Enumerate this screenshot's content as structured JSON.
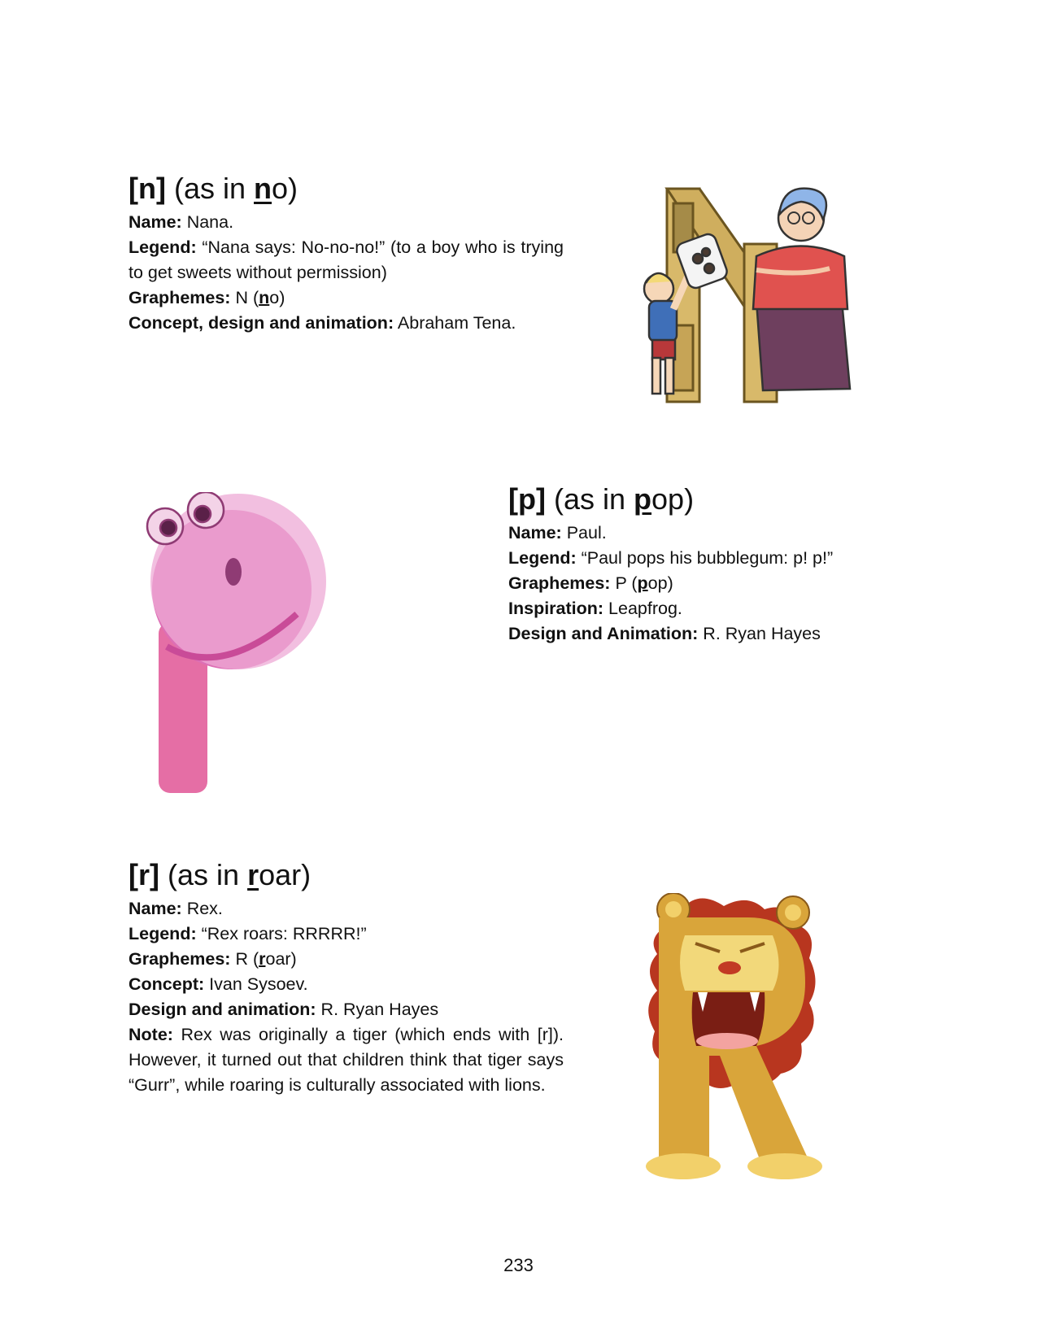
{
  "sections": [
    {
      "symbol": "[n]",
      "as_in": "(as in ",
      "kw_bold": "n",
      "kw_rest": "o)",
      "rows": [
        {
          "label": "Name:",
          "value": " Nana."
        },
        {
          "label": "Legend:",
          "value": " “Nana says: No-no-no!” (to a boy who is trying to get sweets without permission)"
        },
        {
          "label": "Graphemes:",
          "value_a": " N (",
          "value_bold": "n",
          "value_b": "o)"
        },
        {
          "label": "Concept, design and animation:",
          "value": " Abraham Tena."
        }
      ]
    },
    {
      "symbol": "[p]",
      "as_in": "(as in ",
      "kw_bold": "p",
      "kw_rest": "op)",
      "rows": [
        {
          "label": "Name:",
          "value": " Paul."
        },
        {
          "label": "Legend:",
          "value": " “Paul pops his bubblegum: p! p!”"
        },
        {
          "label": "Graphemes:",
          "value_a": " P (",
          "value_bold": "p",
          "value_b": "op)"
        },
        {
          "label": "Inspiration:",
          "value": " Leapfrog."
        },
        {
          "label": "Design and Animation:",
          "value": " R. Ryan Hayes"
        }
      ]
    },
    {
      "symbol": "[r]",
      "as_in": "(as in ",
      "kw_bold": "r",
      "kw_rest": "oar)",
      "rows": [
        {
          "label": "Name:",
          "value": " Rex."
        },
        {
          "label": "Legend:",
          "value": " “Rex roars: RRRRR!”"
        },
        {
          "label": "Graphemes:",
          "value_a": " R (",
          "value_bold": "r",
          "value_b": "oar)"
        },
        {
          "label": "Concept:",
          "value": " Ivan Sysoev."
        },
        {
          "label": "Design and animation:",
          "value": " R. Ryan Hayes"
        },
        {
          "label": "Note:",
          "value": " Rex was originally a tiger (which ends with [r]). However, it turned out that children think that tiger says “Gurr”, while roaring is culturally associated with lions."
        }
      ]
    }
  ],
  "page_number": "233",
  "colors": {
    "door": "#d8b96a",
    "nana_shirt": "#e0524f",
    "nana_skirt": "#6e3f5e",
    "nana_hair": "#8fb5e8",
    "boy_shirt": "#3f6fb8",
    "paul_pink": "#e07ab5",
    "lion_gold": "#d9a53a",
    "lion_mane": "#b8361f"
  }
}
